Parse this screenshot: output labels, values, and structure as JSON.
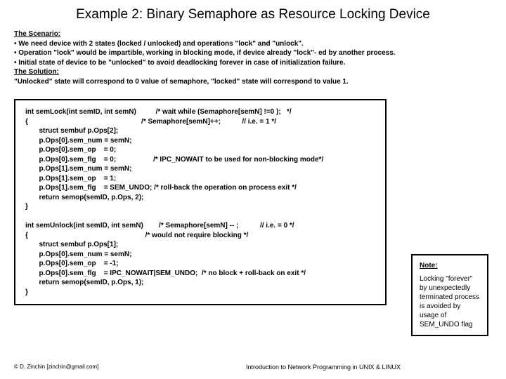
{
  "title": "Example 2: Binary Semaphore as Resource Locking Device",
  "scenario": {
    "h1": "The Scenario:",
    "l1": "• We need device with 2 states (locked / unlocked) and operations \"lock\" and \"unlock\".",
    "l2": "• Operation \"lock\" would be impartible, working in blocking mode, if device already \"lock\"- ed by another process.",
    "l3": "• Initial state of device  to be \"unlocked\"  to avoid deadlocking forever in case of initialization failure.",
    "h2": "The Solution:",
    "l4": "\"Unlocked\" state will correspond to 0 value of semaphore, \"locked\" state will correspond to value 1."
  },
  "code": {
    "c01": "int semLock(int semID, int semN)          /* wait while (Semaphore[semN] !=0 );   */",
    "c02": "{                                                          /* Semaphore[semN]++;           // i.e. = 1 */",
    "c03": "       struct sembuf p.Ops[2];",
    "c04": "       p.Ops[0].sem_num = semN;",
    "c05": "       p.Ops[0].sem_op    = 0;",
    "c06": "       p.Ops[0].sem_flg    = 0;                   /* IPC_NOWAIT to be used for non-blocking mode*/",
    "c07": "       p.Ops[1].sem_num = semN;",
    "c08": "       p.Ops[1].sem_op    = 1;",
    "c09": "       p.Ops[1].sem_flg    = SEM_UNDO; /* roll-back the operation on process exit */",
    "c10": "       return semop(semID, p.Ops, 2);",
    "c11": "}",
    "c12": " ",
    "c13": "int semUnlock(int semID, int semN)        /* Semaphore[semN] -- ;           // i.e. = 0 */",
    "c14": "{                                                            /* would not require blocking */",
    "c15": "       struct sembuf p.Ops[1];",
    "c16": "       p.Ops[0].sem_num = semN;",
    "c17": "       p.Ops[0].sem_op    = -1;",
    "c18": "       p.Ops[0].sem_flg    = IPC_NOWAIT|SEM_UNDO;  /* no block + roll-back on exit */",
    "c19": "       return semop(semID, p.Ops, 1);",
    "c20": "}"
  },
  "note": {
    "heading": "Note:",
    "body": "Locking \"forever\" by unexpectedly terminated process is avoided by usage of SEM_UNDO flag"
  },
  "footer": {
    "left": "© D. Zinchin [zinchin@gmail.com]",
    "center": "Introduction to Network Programming in UNIX & LINUX"
  }
}
